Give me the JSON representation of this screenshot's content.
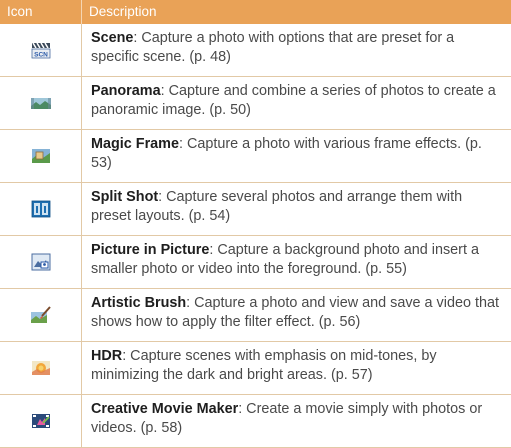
{
  "header": {
    "icon_label": "Icon",
    "description_label": "Description"
  },
  "rows": [
    {
      "icon": "scene-icon",
      "title": "Scene",
      "text": ": Capture a photo with options that are preset for a specific scene. (p. 48)"
    },
    {
      "icon": "panorama-icon",
      "title": "Panorama",
      "text": ": Capture and combine a series of photos to create a panoramic image. (p. 50)"
    },
    {
      "icon": "magic-frame-icon",
      "title": "Magic Frame",
      "text": ": Capture a photo with various frame effects. (p. 53)"
    },
    {
      "icon": "split-shot-icon",
      "title": "Split Shot",
      "text": ": Capture several photos and arrange them with preset layouts. (p. 54)"
    },
    {
      "icon": "picture-in-picture-icon",
      "title": "Picture in Picture",
      "text": ": Capture a background photo and insert a smaller photo or video into the foreground. (p. 55)"
    },
    {
      "icon": "artistic-brush-icon",
      "title": "Artistic Brush",
      "text": ": Capture a photo and view and save a video that shows how to apply the filter effect. (p. 56)"
    },
    {
      "icon": "hdr-icon",
      "title": "HDR",
      "text": ": Capture scenes with emphasis on mid-tones, by minimizing the dark and bright areas. (p. 57)"
    },
    {
      "icon": "creative-movie-maker-icon",
      "title": "Creative Movie Maker",
      "text": ": Create a movie simply with photos or videos. (p. 58)"
    }
  ],
  "scene_icon_text": "SCN",
  "colors": {
    "header_bg": "#e9a257",
    "rule": "#e2c9a6"
  }
}
